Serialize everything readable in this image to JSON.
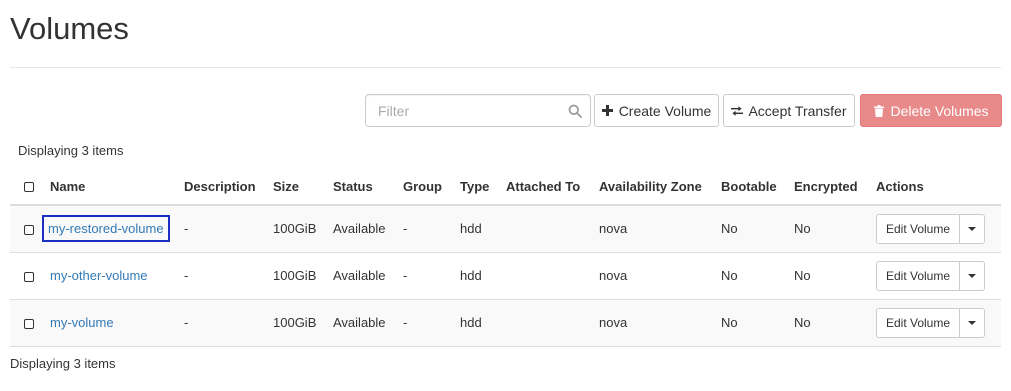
{
  "page": {
    "title": "Volumes"
  },
  "toolbar": {
    "filter_placeholder": "Filter",
    "filter_value": "",
    "create_label": "Create Volume",
    "accept_label": "Accept Transfer",
    "delete_label": "Delete Volumes"
  },
  "summary": {
    "top": "Displaying 3 items",
    "bottom": "Displaying 3 items"
  },
  "table": {
    "columns": [
      "Name",
      "Description",
      "Size",
      "Status",
      "Group",
      "Type",
      "Attached To",
      "Availability Zone",
      "Bootable",
      "Encrypted",
      "Actions"
    ],
    "rows": [
      {
        "name": "my-restored-volume",
        "description": "-",
        "size": "100GiB",
        "status": "Available",
        "group": "-",
        "type": "hdd",
        "attached_to": "",
        "availability_zone": "nova",
        "bootable": "No",
        "encrypted": "No",
        "action": "Edit Volume"
      },
      {
        "name": "my-other-volume",
        "description": "-",
        "size": "100GiB",
        "status": "Available",
        "group": "-",
        "type": "hdd",
        "attached_to": "",
        "availability_zone": "nova",
        "bootable": "No",
        "encrypted": "No",
        "action": "Edit Volume"
      },
      {
        "name": "my-volume",
        "description": "-",
        "size": "100GiB",
        "status": "Available",
        "group": "-",
        "type": "hdd",
        "attached_to": "",
        "availability_zone": "nova",
        "bootable": "No",
        "encrypted": "No",
        "action": "Edit Volume"
      }
    ]
  },
  "colors": {
    "link": "#337ab7",
    "danger_button": "#e8898a",
    "focus_outline": "#1a2fbf"
  },
  "icons": {
    "create": "plus-icon",
    "accept": "exchange-icon",
    "delete": "trash-icon",
    "filter": "search-icon",
    "action_menu": "caret-down-icon"
  }
}
